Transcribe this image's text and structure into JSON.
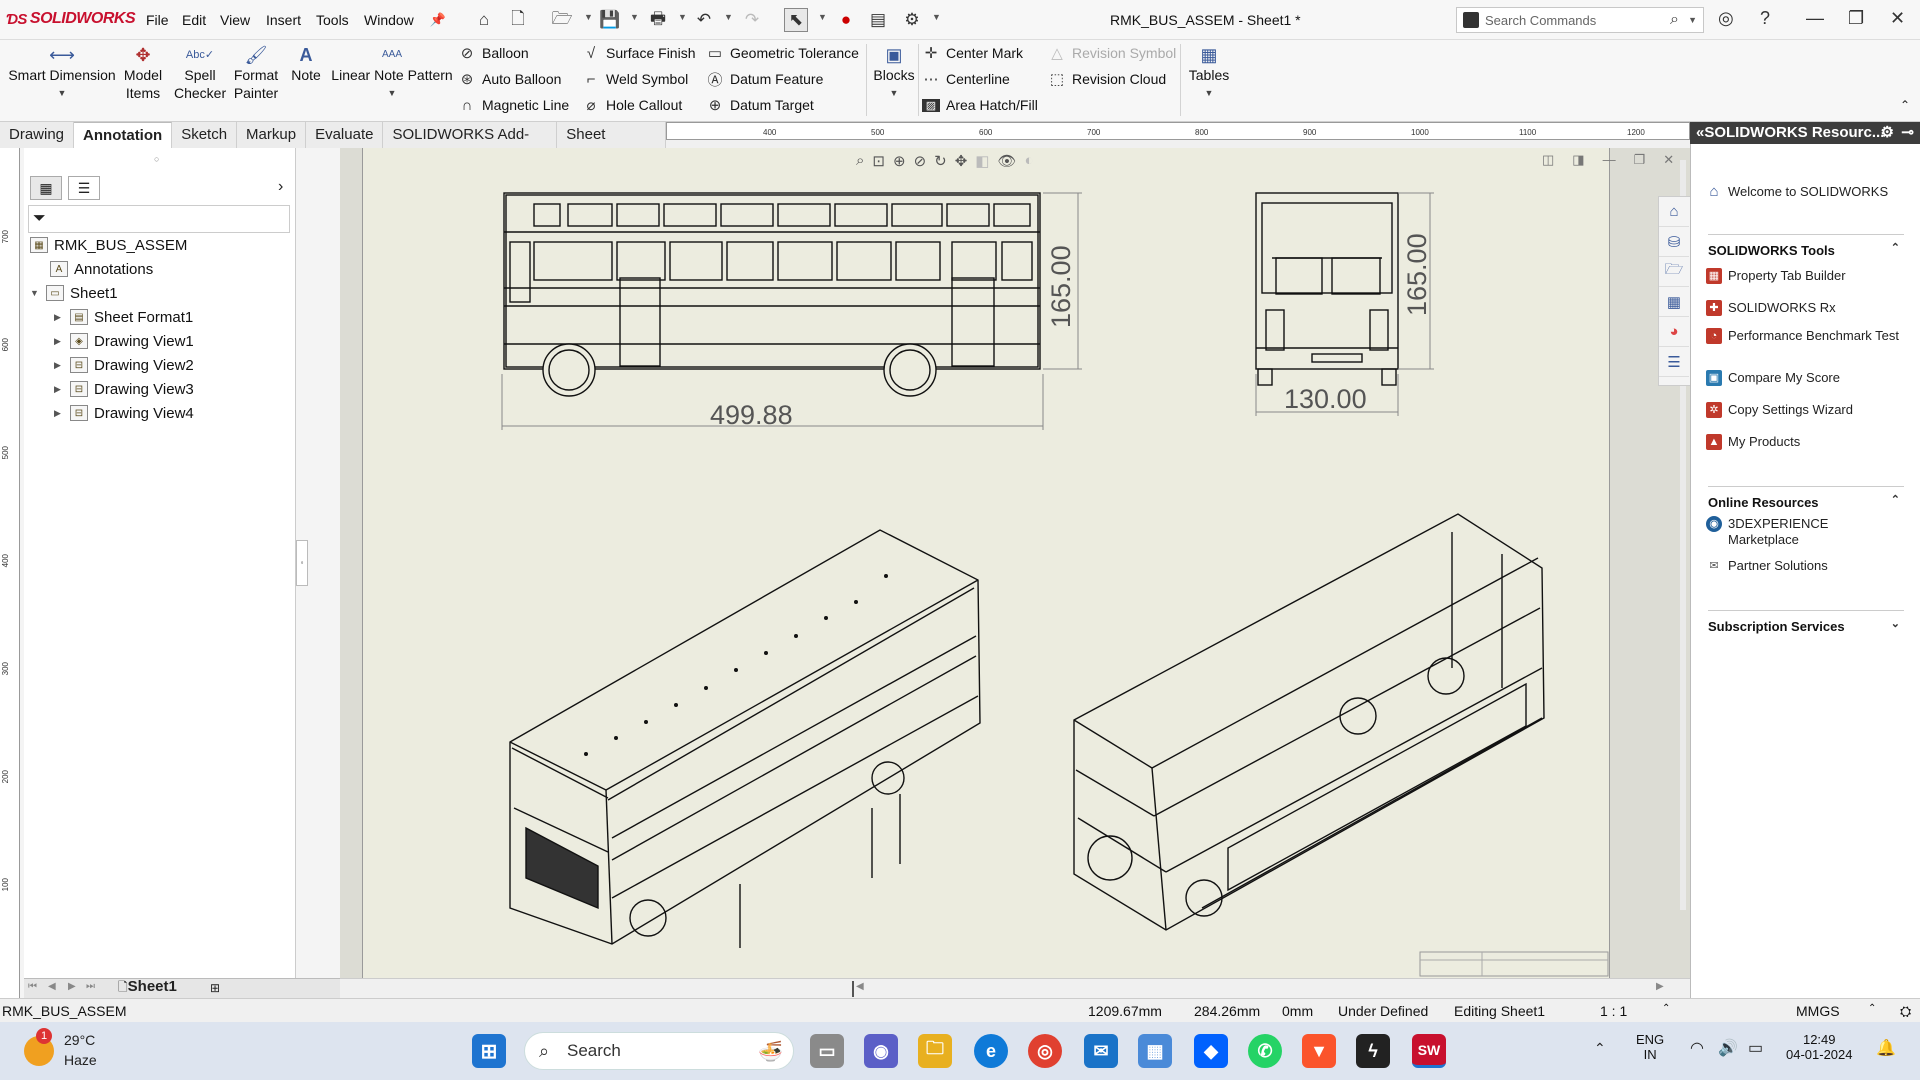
{
  "app": {
    "brand": "SOLIDWORKS",
    "title": "RMK_BUS_ASSEM - Sheet1 *"
  },
  "menu": [
    "File",
    "Edit",
    "View",
    "Insert",
    "Tools",
    "Window"
  ],
  "search": {
    "placeholder": "Search Commands"
  },
  "ribbon": {
    "smart_dimension": "Smart Dimension",
    "model_items": "Model Items",
    "spell_checker": "Spell Checker",
    "format_painter": "Format Painter",
    "note": "Note",
    "linear_note_pattern": "Linear Note Pattern",
    "balloon": "Balloon",
    "auto_balloon": "Auto Balloon",
    "magnetic_line": "Magnetic Line",
    "surface_finish": "Surface Finish",
    "weld_symbol": "Weld Symbol",
    "hole_callout": "Hole Callout",
    "geometric_tolerance": "Geometric Tolerance",
    "datum_feature": "Datum Feature",
    "datum_target": "Datum Target",
    "blocks": "Blocks",
    "center_mark": "Center Mark",
    "centerline": "Centerline",
    "area_hatch": "Area Hatch/Fill",
    "revision_symbol": "Revision Symbol",
    "revision_cloud": "Revision Cloud",
    "tables": "Tables"
  },
  "tabs": [
    "Drawing",
    "Annotation",
    "Sketch",
    "Markup",
    "Evaluate",
    "SOLIDWORKS Add-Ins",
    "Sheet Format"
  ],
  "active_tab": "Annotation",
  "ruler": {
    "h": [
      "400",
      "500",
      "600",
      "700",
      "800",
      "900",
      "1000",
      "1100",
      "1200"
    ],
    "v": [
      "700",
      "600",
      "500",
      "400",
      "300",
      "200",
      "100"
    ]
  },
  "tree": {
    "root": "RMK_BUS_ASSEM",
    "items": [
      "Annotations",
      "Sheet1",
      "Sheet Format1",
      "Drawing View1",
      "Drawing View2",
      "Drawing View3",
      "Drawing View4"
    ]
  },
  "sheet_tab": "Sheet1",
  "dimensions": {
    "length": "499.88",
    "height_side": "165.00",
    "height_front": "165.00",
    "width": "130.00"
  },
  "taskpane": {
    "title": "SOLIDWORKS Resourc...",
    "welcome": "Welcome to SOLIDWORKS",
    "tools_header": "SOLIDWORKS Tools",
    "tools": [
      "Property Tab Builder",
      "SOLIDWORKS Rx",
      "Performance Benchmark Test",
      "Compare My Score",
      "Copy Settings Wizard",
      "My Products"
    ],
    "online_header": "Online Resources",
    "online": [
      "3DEXPERIENCE Marketplace",
      "Partner Solutions"
    ],
    "subscription_header": "Subscription Services"
  },
  "status": {
    "doc": "RMK_BUS_ASSEM",
    "x": "1209.67mm",
    "y": "284.26mm",
    "z": "0mm",
    "state": "Under Defined",
    "editing": "Editing Sheet1",
    "scale": "1 : 1",
    "units": "MMGS"
  },
  "taskbar": {
    "temp": "29°C",
    "weather": "Haze",
    "badge": "1",
    "search": "Search",
    "lang1": "ENG",
    "lang2": "IN",
    "time": "12:49",
    "date": "04-01-2024"
  }
}
